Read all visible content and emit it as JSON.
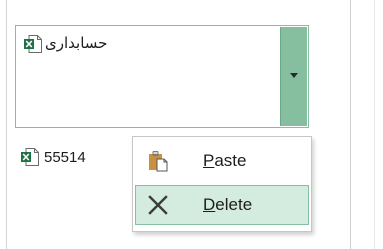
{
  "list": {
    "selected_item": {
      "name": "حسابداری",
      "icon": "excel-file-icon"
    },
    "items": [
      {
        "name": "55514",
        "icon": "excel-file-icon"
      }
    ]
  },
  "context_menu": {
    "items": [
      {
        "label_accel": "P",
        "label_rest": "aste",
        "icon": "paste-icon"
      },
      {
        "label_accel": "D",
        "label_rest": "elete",
        "icon": "close-icon"
      }
    ]
  },
  "colors": {
    "accent_green": "#86bf9f",
    "hover_green": "#d3ecdf",
    "excel_green": "#1e7145"
  }
}
